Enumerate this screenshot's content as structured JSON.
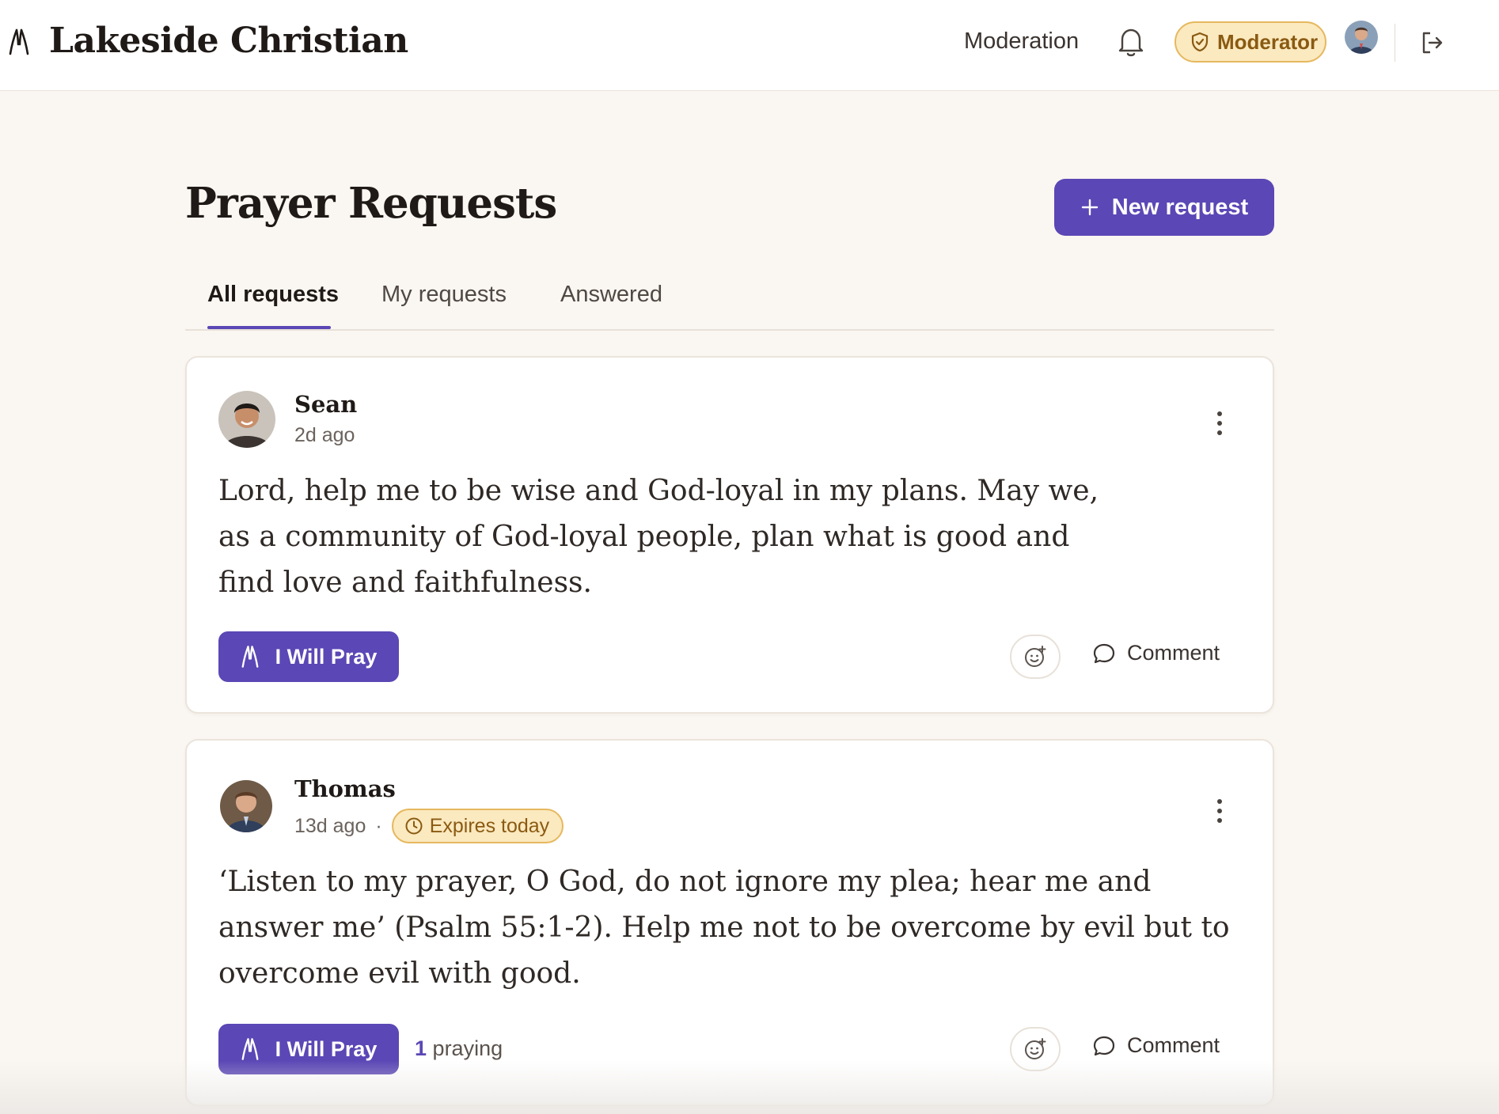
{
  "header": {
    "brand": "Lakeside Christian",
    "nav_moderation": "Moderation",
    "role_badge": "Moderator",
    "icons": [
      "praying-hands-icon",
      "bell-icon",
      "shield-icon",
      "logout-icon"
    ]
  },
  "page": {
    "title": "Prayer Requests",
    "new_button": "New request"
  },
  "tabs": [
    {
      "label": "All requests",
      "active": true
    },
    {
      "label": "My requests",
      "active": false
    },
    {
      "label": "Answered",
      "active": false
    }
  ],
  "requests": [
    {
      "author": "Sean",
      "time": "2d ago",
      "text": "Lord, help me to be wise and God-loyal in my plans. May we, as a community of God-loyal people, plan what is good and find love and faithfulness.",
      "pray_label": "I Will Pray",
      "comment_label": "Comment"
    },
    {
      "author": "Thomas",
      "time": "13d ago",
      "separator": "·",
      "badge": "Expires today",
      "text": "‘Listen to my prayer, O God, do not ignore my plea; hear me and answer me’ (Psalm 55:1-2). Help me not to be overcome by evil but to overcome evil with good.",
      "pray_label": "I Will Pray",
      "praying_count": "1",
      "praying_label": "praying",
      "comment_label": "Comment"
    }
  ],
  "colors": {
    "accent": "#5b47b5",
    "badge_bg": "#fbe9bf",
    "badge_border": "#e6b85e",
    "page_bg": "#faf6f1"
  }
}
